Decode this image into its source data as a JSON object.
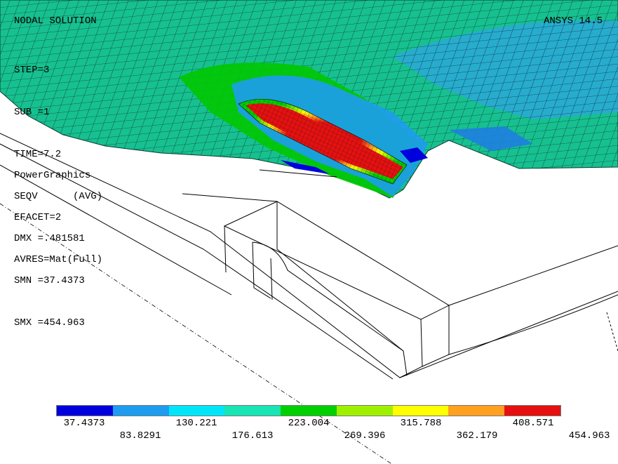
{
  "header": {
    "plot_title": "NODAL SOLUTION",
    "version": "ANSYS 14.5"
  },
  "info": {
    "step": "STEP=3",
    "sub": "SUB =1",
    "time": "TIME=7.2",
    "result": "SEQV      (AVG)",
    "dmx": "DMX =.481581",
    "smn": "SMN =37.4373",
    "smx": "SMX =454.963"
  },
  "graphics": {
    "mode": "PowerGraphics",
    "efacet": "EFACET=2",
    "avres": "AVRES=Mat(Full)"
  },
  "legend": {
    "colors": [
      "#0000dd",
      "#1e9cf0",
      "#00e6f8",
      "#18e4b4",
      "#00d000",
      "#9ff000",
      "#ffff00",
      "#ffa020",
      "#e61010"
    ],
    "values_row1": [
      "37.4373",
      "130.221",
      "223.004",
      "315.788",
      "408.571"
    ],
    "values_row2": [
      "83.8291",
      "176.613",
      "269.396",
      "362.179",
      "454.963"
    ]
  }
}
